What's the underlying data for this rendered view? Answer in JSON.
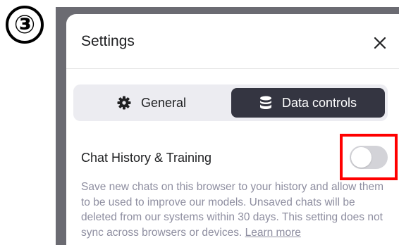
{
  "step_marker": "③",
  "dialog": {
    "title": "Settings",
    "close_icon": "close-icon"
  },
  "tabs": [
    {
      "label": "General",
      "icon": "gear-icon",
      "selected": false
    },
    {
      "label": "Data controls",
      "icon": "database-icon",
      "selected": true
    }
  ],
  "setting": {
    "label": "Chat History & Training",
    "toggle_on": false,
    "description": "Save new chats on this browser to your history and allow them to be used to improve our models. Unsaved chats will be deleted from our systems within 30 days. This setting does not sync across browsers or devices.",
    "learn_more": "Learn more"
  },
  "colors": {
    "highlight": "#ff0000",
    "selected_tab_bg": "#343541",
    "tabs_bg": "#ececf1",
    "toggle_off": "#d3d3d8"
  }
}
